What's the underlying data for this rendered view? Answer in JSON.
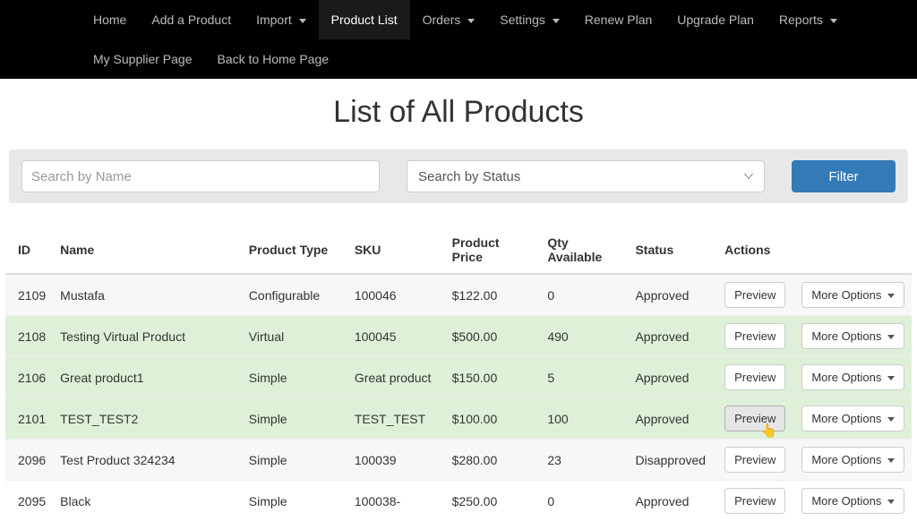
{
  "nav": {
    "row1": [
      {
        "label": "Home",
        "dropdown": false,
        "active": false
      },
      {
        "label": "Add a Product",
        "dropdown": false,
        "active": false
      },
      {
        "label": "Import",
        "dropdown": true,
        "active": false
      },
      {
        "label": "Product List",
        "dropdown": false,
        "active": true
      },
      {
        "label": "Orders",
        "dropdown": true,
        "active": false
      },
      {
        "label": "Settings",
        "dropdown": true,
        "active": false
      },
      {
        "label": "Renew Plan",
        "dropdown": false,
        "active": false
      },
      {
        "label": "Upgrade Plan",
        "dropdown": false,
        "active": false
      },
      {
        "label": "Reports",
        "dropdown": true,
        "active": false
      }
    ],
    "row2": [
      {
        "label": "My Supplier Page",
        "dropdown": false,
        "active": false
      },
      {
        "label": "Back to Home Page",
        "dropdown": false,
        "active": false
      }
    ]
  },
  "page_title": "List of All Products",
  "filters": {
    "name_placeholder": "Search by Name",
    "name_value": "",
    "status_placeholder": "Search by Status",
    "filter_button": "Filter"
  },
  "table": {
    "columns": [
      "ID",
      "Name",
      "Product Type",
      "SKU",
      "Product Price",
      "Qty Available",
      "Status",
      "Actions"
    ],
    "preview_label": "Preview",
    "more_label": "More Options",
    "rows": [
      {
        "id": "2109",
        "name": "Mustafa",
        "type": "Configurable",
        "sku": "100046",
        "price": "$122.00",
        "qty": "0",
        "status": "Approved",
        "rowstyle": "odd",
        "hover": false
      },
      {
        "id": "2108",
        "name": "Testing Virtual Product",
        "type": "Virtual",
        "sku": "100045",
        "price": "$500.00",
        "qty": "490",
        "status": "Approved",
        "rowstyle": "green",
        "hover": false
      },
      {
        "id": "2106",
        "name": "Great product1",
        "type": "Simple",
        "sku": "Great product",
        "price": "$150.00",
        "qty": "5",
        "status": "Approved",
        "rowstyle": "green",
        "hover": false
      },
      {
        "id": "2101",
        "name": "TEST_TEST2",
        "type": "Simple",
        "sku": "TEST_TEST",
        "price": "$100.00",
        "qty": "100",
        "status": "Approved",
        "rowstyle": "green",
        "hover": true
      },
      {
        "id": "2096",
        "name": "Test Product 324234",
        "type": "Simple",
        "sku": "100039",
        "price": "$280.00",
        "qty": "23",
        "status": "Disapproved",
        "rowstyle": "odd",
        "hover": false
      },
      {
        "id": "2095",
        "name": "Black",
        "type": "Simple",
        "sku": "100038-",
        "price": "$250.00",
        "qty": "0",
        "status": "Approved",
        "rowstyle": "",
        "hover": false
      }
    ]
  }
}
